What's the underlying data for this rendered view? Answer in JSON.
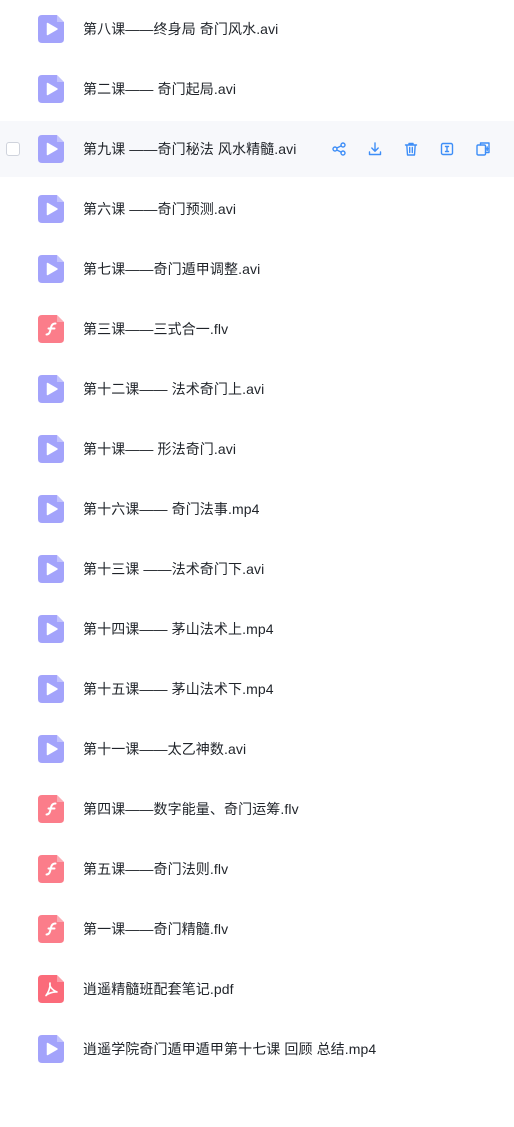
{
  "colors": {
    "video_icon": "#a3a3fb",
    "flash_icon": "#fb7d8a",
    "pdf_icon": "#fb6b7a",
    "action_icon": "#3e8ef7",
    "hover_row_bg": "#f7f8fb"
  },
  "hover_actions": [
    {
      "name": "share-icon"
    },
    {
      "name": "download-icon"
    },
    {
      "name": "delete-icon"
    },
    {
      "name": "rename-icon"
    },
    {
      "name": "copy-icon"
    }
  ],
  "files": [
    {
      "name": "第八课——终身局 奇门风水.avi",
      "icon": "video-file-icon"
    },
    {
      "name": "第二课—— 奇门起局.avi",
      "icon": "video-file-icon"
    },
    {
      "name": "第九课 ——奇门秘法 风水精髓.avi",
      "icon": "video-file-icon"
    },
    {
      "name": "第六课 ——奇门预测.avi",
      "icon": "video-file-icon"
    },
    {
      "name": "第七课——奇门遁甲调整.avi",
      "icon": "video-file-icon"
    },
    {
      "name": "第三课——三式合一.flv",
      "icon": "flash-file-icon"
    },
    {
      "name": "第十二课—— 法术奇门上.avi",
      "icon": "video-file-icon"
    },
    {
      "name": "第十课—— 形法奇门.avi",
      "icon": "video-file-icon"
    },
    {
      "name": "第十六课—— 奇门法事.mp4",
      "icon": "video-file-icon"
    },
    {
      "name": "第十三课 ——法术奇门下.avi",
      "icon": "video-file-icon"
    },
    {
      "name": "第十四课—— 茅山法术上.mp4",
      "icon": "video-file-icon"
    },
    {
      "name": "第十五课—— 茅山法术下.mp4",
      "icon": "video-file-icon"
    },
    {
      "name": "第十一课——太乙神数.avi",
      "icon": "video-file-icon"
    },
    {
      "name": "第四课——数字能量、奇门运筹.flv",
      "icon": "flash-file-icon"
    },
    {
      "name": "第五课——奇门法则.flv",
      "icon": "flash-file-icon"
    },
    {
      "name": "第一课——奇门精髓.flv",
      "icon": "flash-file-icon"
    },
    {
      "name": "逍遥精髓班配套笔记.pdf",
      "icon": "pdf-file-icon"
    },
    {
      "name": "逍遥学院奇门遁甲遁甲第十七课 回顾 总结.mp4",
      "icon": "video-file-icon"
    }
  ]
}
